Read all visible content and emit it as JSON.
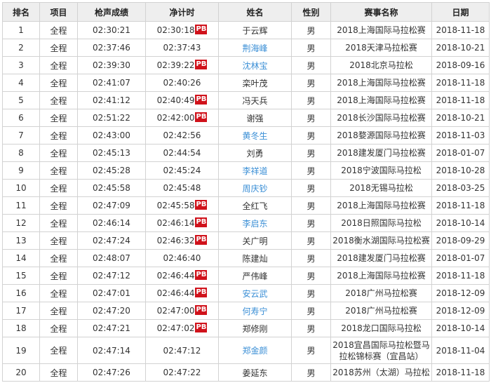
{
  "headers": [
    "排名",
    "项目",
    "枪声成绩",
    "净计时",
    "姓名",
    "性别",
    "赛事名称",
    "日期"
  ],
  "pb_label": "PB",
  "colors": {
    "header_bg": "#eeeeee",
    "border": "#d2d2d2",
    "pb_badge": "#d0121b",
    "link": "#3b8fd6"
  },
  "rows": [
    {
      "rank": "1",
      "project": "全程",
      "gun": "02:30:21",
      "net": "02:30:18",
      "pb": true,
      "name": "于云辉",
      "link": false,
      "gender": "男",
      "event": "2018上海国际马拉松赛",
      "date": "2018-11-18"
    },
    {
      "rank": "2",
      "project": "全程",
      "gun": "02:37:46",
      "net": "02:37:43",
      "pb": false,
      "name": "荆海峰",
      "link": true,
      "gender": "男",
      "event": "2018天津马拉松赛",
      "date": "2018-10-21"
    },
    {
      "rank": "3",
      "project": "全程",
      "gun": "02:39:30",
      "net": "02:39:22",
      "pb": true,
      "name": "沈林宝",
      "link": true,
      "gender": "男",
      "event": "2018北京马拉松",
      "date": "2018-09-16"
    },
    {
      "rank": "4",
      "project": "全程",
      "gun": "02:41:07",
      "net": "02:40:26",
      "pb": false,
      "name": "栾叶茂",
      "link": false,
      "gender": "男",
      "event": "2018上海国际马拉松赛",
      "date": "2018-11-18"
    },
    {
      "rank": "5",
      "project": "全程",
      "gun": "02:41:12",
      "net": "02:40:49",
      "pb": true,
      "name": "冯天兵",
      "link": false,
      "gender": "男",
      "event": "2018上海国际马拉松赛",
      "date": "2018-11-18"
    },
    {
      "rank": "6",
      "project": "全程",
      "gun": "02:51:22",
      "net": "02:42:00",
      "pb": true,
      "name": "谢强",
      "link": false,
      "gender": "男",
      "event": "2018长沙国际马拉松赛",
      "date": "2018-10-21"
    },
    {
      "rank": "7",
      "project": "全程",
      "gun": "02:43:00",
      "net": "02:42:56",
      "pb": false,
      "name": "黄冬生",
      "link": true,
      "gender": "男",
      "event": "2018婺源国际马拉松赛",
      "date": "2018-11-03"
    },
    {
      "rank": "8",
      "project": "全程",
      "gun": "02:45:13",
      "net": "02:44:54",
      "pb": false,
      "name": "刘勇",
      "link": false,
      "gender": "男",
      "event": "2018建发厦门马拉松赛",
      "date": "2018-01-07"
    },
    {
      "rank": "9",
      "project": "全程",
      "gun": "02:45:28",
      "net": "02:45:24",
      "pb": false,
      "name": "李祥道",
      "link": true,
      "gender": "男",
      "event": "2018宁波国际马拉松",
      "date": "2018-10-28"
    },
    {
      "rank": "10",
      "project": "全程",
      "gun": "02:45:58",
      "net": "02:45:48",
      "pb": false,
      "name": "周庆钞",
      "link": true,
      "gender": "男",
      "event": "2018无锡马拉松",
      "date": "2018-03-25"
    },
    {
      "rank": "11",
      "project": "全程",
      "gun": "02:47:09",
      "net": "02:45:58",
      "pb": true,
      "name": "全红飞",
      "link": false,
      "gender": "男",
      "event": "2018上海国际马拉松赛",
      "date": "2018-11-18"
    },
    {
      "rank": "12",
      "project": "全程",
      "gun": "02:46:14",
      "net": "02:46:14",
      "pb": true,
      "name": "李启东",
      "link": true,
      "gender": "男",
      "event": "2018日照国际马拉松",
      "date": "2018-10-14"
    },
    {
      "rank": "13",
      "project": "全程",
      "gun": "02:47:24",
      "net": "02:46:32",
      "pb": true,
      "name": "关广明",
      "link": false,
      "gender": "男",
      "event": "2018衡水湖国际马拉松赛",
      "date": "2018-09-29"
    },
    {
      "rank": "14",
      "project": "全程",
      "gun": "02:48:07",
      "net": "02:46:40",
      "pb": false,
      "name": "陈建灿",
      "link": false,
      "gender": "男",
      "event": "2018建发厦门马拉松赛",
      "date": "2018-01-07"
    },
    {
      "rank": "15",
      "project": "全程",
      "gun": "02:47:12",
      "net": "02:46:44",
      "pb": true,
      "name": "严伟峰",
      "link": false,
      "gender": "男",
      "event": "2018上海国际马拉松赛",
      "date": "2018-11-18"
    },
    {
      "rank": "16",
      "project": "全程",
      "gun": "02:47:01",
      "net": "02:46:44",
      "pb": true,
      "name": "安云武",
      "link": true,
      "gender": "男",
      "event": "2018广州马拉松赛",
      "date": "2018-12-09"
    },
    {
      "rank": "17",
      "project": "全程",
      "gun": "02:47:20",
      "net": "02:47:00",
      "pb": true,
      "name": "何寿宁",
      "link": true,
      "gender": "男",
      "event": "2018广州马拉松赛",
      "date": "2018-12-09"
    },
    {
      "rank": "18",
      "project": "全程",
      "gun": "02:47:21",
      "net": "02:47:02",
      "pb": true,
      "name": "郑修刚",
      "link": false,
      "gender": "男",
      "event": "2018龙口国际马拉松",
      "date": "2018-10-14"
    },
    {
      "rank": "19",
      "project": "全程",
      "gun": "02:47:14",
      "net": "02:47:12",
      "pb": false,
      "name": "郑金颜",
      "link": true,
      "gender": "男",
      "event": "2018宜昌国际马拉松暨马拉松锦标赛（宜昌站）",
      "date": "2018-11-04",
      "tall": true
    },
    {
      "rank": "20",
      "project": "全程",
      "gun": "02:47:26",
      "net": "02:47:22",
      "pb": false,
      "name": "姜延东",
      "link": false,
      "gender": "男",
      "event": "2018苏州（太湖）马拉松",
      "date": "2018-11-18"
    }
  ]
}
